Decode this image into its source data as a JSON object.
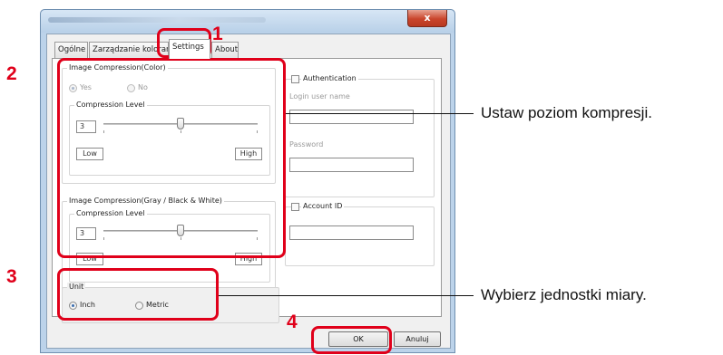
{
  "window": {
    "close_label": "x"
  },
  "tabs": [
    {
      "label": "Ogólne"
    },
    {
      "label": "Zarządzanie kolorami"
    },
    {
      "label": "Settings"
    },
    {
      "label": "About"
    }
  ],
  "compression_color": {
    "legend": "Image Compression(Color)",
    "yes_label": "Yes",
    "no_label": "No",
    "selected": "Yes",
    "level_legend": "Compression Level",
    "level_value": "3",
    "slider_fraction": 0.5,
    "low_label": "Low",
    "high_label": "High"
  },
  "compression_gray": {
    "legend": "Image Compression(Gray / Black & White)",
    "level_legend": "Compression Level",
    "level_value": "3",
    "slider_fraction": 0.5,
    "low_label": "Low",
    "high_label": "High"
  },
  "unit": {
    "legend": "Unit",
    "inch_label": "Inch",
    "metric_label": "Metric",
    "selected": "Inch"
  },
  "authentication": {
    "label": "Authentication",
    "checked": false,
    "login_label": "Login user name",
    "login_value": "",
    "password_label": "Password",
    "password_value": ""
  },
  "account": {
    "label": "Account ID",
    "checked": false,
    "value": ""
  },
  "buttons": {
    "ok": "OK",
    "cancel": "Anuluj"
  },
  "callouts": {
    "n1": "1",
    "n2": "2",
    "n3": "3",
    "n4": "4",
    "compression_text": "Ustaw poziom kompresji.",
    "unit_text": "Wybierz jednostki miary."
  },
  "colors": {
    "highlight": "#e0001a",
    "window_frame": "#bcd3ea",
    "close_button": "#c9452c"
  }
}
